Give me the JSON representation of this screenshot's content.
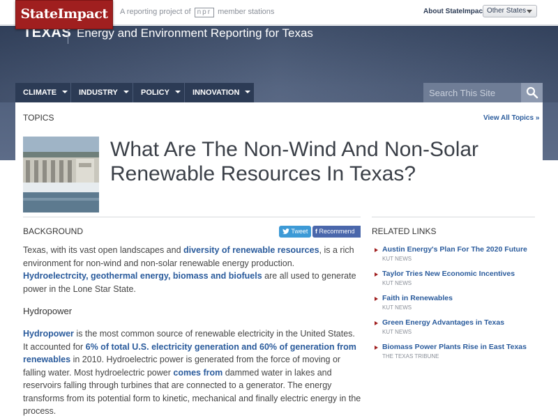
{
  "brand": {
    "logo": "StateImpact",
    "tagline_pre": "A reporting project of",
    "tagline_npr": "npr",
    "tagline_post": "member stations"
  },
  "topbar": {
    "about": "About StateImpact",
    "states": "Other States"
  },
  "header": {
    "state": "TEXAS",
    "subtitle": "Energy and Environment Reporting for Texas"
  },
  "nav": {
    "items": [
      {
        "label": "CLIMATE"
      },
      {
        "label": "INDUSTRY"
      },
      {
        "label": "POLICY"
      },
      {
        "label": "INNOVATION"
      }
    ]
  },
  "search": {
    "placeholder": "Search This Site"
  },
  "topics": {
    "label": "TOPICS",
    "view_all": "View All Topics »"
  },
  "article": {
    "title": "What Are The Non-Wind And Non-Solar Renewable Resources In Texas?",
    "section": "BACKGROUND",
    "share": {
      "tweet": "Tweet",
      "recommend": "Recommend"
    },
    "p1": {
      "a": "Texas, with its vast open landscapes and ",
      "link1": "diversity of renewable resources",
      "b": ", is a rich environment for non-wind and non-solar renewable energy production. ",
      "link2": "Hydroelectrcity, geothermal energy, biomass and biofuels",
      "c": " are all used to generate power in the Lone Star State."
    },
    "h_hydro": "Hydropower",
    "p2": {
      "link1": "Hydropower",
      "a": " is the most common source of renewable electricity in the United States. It accounted for ",
      "link2": "6% of total U.S. electricity generation and 60% of generation from renewables",
      "b": " in 2010. Hydroelectric power is generated from the force of moving or falling water. Most hydroelectric power ",
      "link3": "comes from",
      "c": " dammed water in lakes and reservoirs falling through turbines that are connected to a generator. The energy transforms from its potential form to kinetic, mechanical and finally electric energy in the process."
    }
  },
  "related": {
    "label": "RELATED LINKS",
    "items": [
      {
        "title": "Austin Energy's Plan For The 2020 Future",
        "source": "KUT NEWS"
      },
      {
        "title": "Taylor Tries New Economic Incentives",
        "source": "KUT NEWS"
      },
      {
        "title": "Faith in Renewables",
        "source": "KUT NEWS"
      },
      {
        "title": "Green Energy Advantages in Texas",
        "source": "KUT NEWS"
      },
      {
        "title": "Biomass Power Plants Rise in East Texas",
        "source": "THE TEXAS TRIBUNE"
      }
    ]
  },
  "colors": {
    "brand_red": "#a01f1f",
    "nav_bg": "#2c3b55",
    "link": "#2a5b9c"
  }
}
